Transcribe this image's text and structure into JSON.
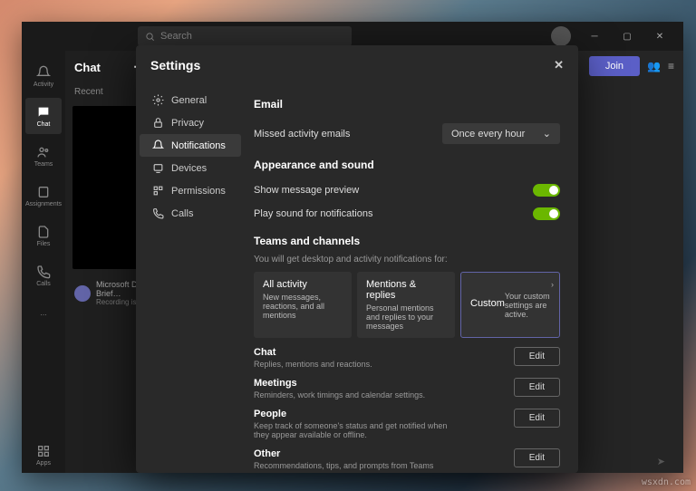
{
  "search_placeholder": "Search",
  "join_label": "Join",
  "leftbar": [
    {
      "label": "Activity"
    },
    {
      "label": "Chat"
    },
    {
      "label": "Teams"
    },
    {
      "label": "Assignments"
    },
    {
      "label": "Files"
    },
    {
      "label": "Calls"
    }
  ],
  "apps_label": "Apps",
  "chat": {
    "title": "Chat",
    "recent": "Recent",
    "meeting_title": "Microsoft Digital Brief…",
    "meeting_sub": "Recording is ready"
  },
  "settings": {
    "title": "Settings",
    "nav": [
      "General",
      "Privacy",
      "Notifications",
      "Devices",
      "Permissions",
      "Calls"
    ],
    "email": {
      "hdr": "Email",
      "row": "Missed activity emails",
      "val": "Once every hour"
    },
    "appearance": {
      "hdr": "Appearance and sound",
      "r1": "Show message preview",
      "r2": "Play sound for notifications"
    },
    "teams": {
      "hdr": "Teams and channels",
      "sub": "You will get desktop and activity notifications for:",
      "cards": [
        {
          "t": "All activity",
          "d": "New messages, reactions, and all mentions"
        },
        {
          "t": "Mentions & replies",
          "d": "Personal mentions and replies to your messages"
        },
        {
          "t": "Custom",
          "d": "Your custom settings are active."
        }
      ]
    },
    "sections": [
      {
        "t": "Chat",
        "d": "Replies, mentions and reactions."
      },
      {
        "t": "Meetings",
        "d": "Reminders, work timings and calendar settings."
      },
      {
        "t": "People",
        "d": "Keep track of someone's status and get notified when they appear available or offline."
      },
      {
        "t": "Other",
        "d": "Recommendations, tips, and prompts from Teams"
      }
    ],
    "edit_label": "Edit"
  },
  "watermark": "wsxdn.com"
}
